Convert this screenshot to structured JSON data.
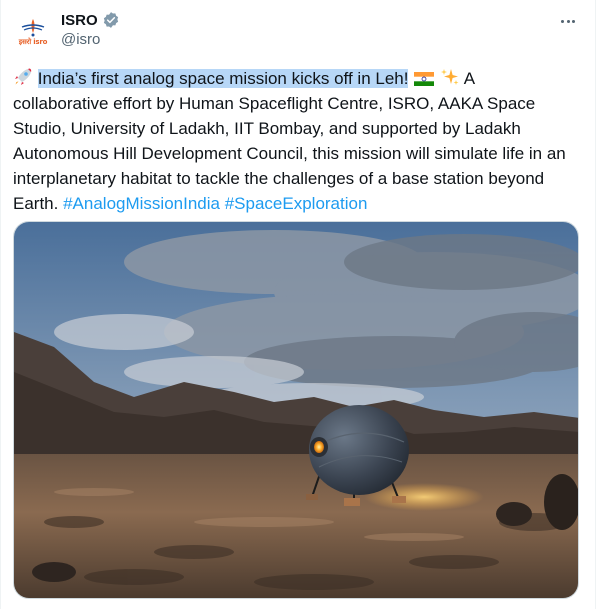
{
  "account": {
    "display_name": "ISRO",
    "handle": "@isro",
    "avatar_logo_text": "इसरो isro"
  },
  "tweet": {
    "highlighted_text": "India’s first analog space mission kicks off in Leh!",
    "body_text": " A collaborative effort by Human Spaceflight Centre, ISRO, AAKA Space Studio, University of Ladakh, IIT Bombay, and supported by Ladakh Autonomous Hill Development Council, this mission will simulate life in an interplanetary habitat to tackle the challenges of a base station beyond Earth. ",
    "hashtags": [
      "#AnalogMissionIndia",
      "#SpaceExploration"
    ]
  },
  "icons": {
    "verified": "verified-badge-icon",
    "more": "more-options-icon",
    "rocket": "rocket-emoji-icon",
    "flag": "india-flag-emoji-icon",
    "sparkles": "sparkles-emoji-icon"
  },
  "colors": {
    "link": "#1d9bf0",
    "highlight": "#b7d7f7",
    "secondary_text": "#536471",
    "brand_orange": "#e8632b"
  }
}
